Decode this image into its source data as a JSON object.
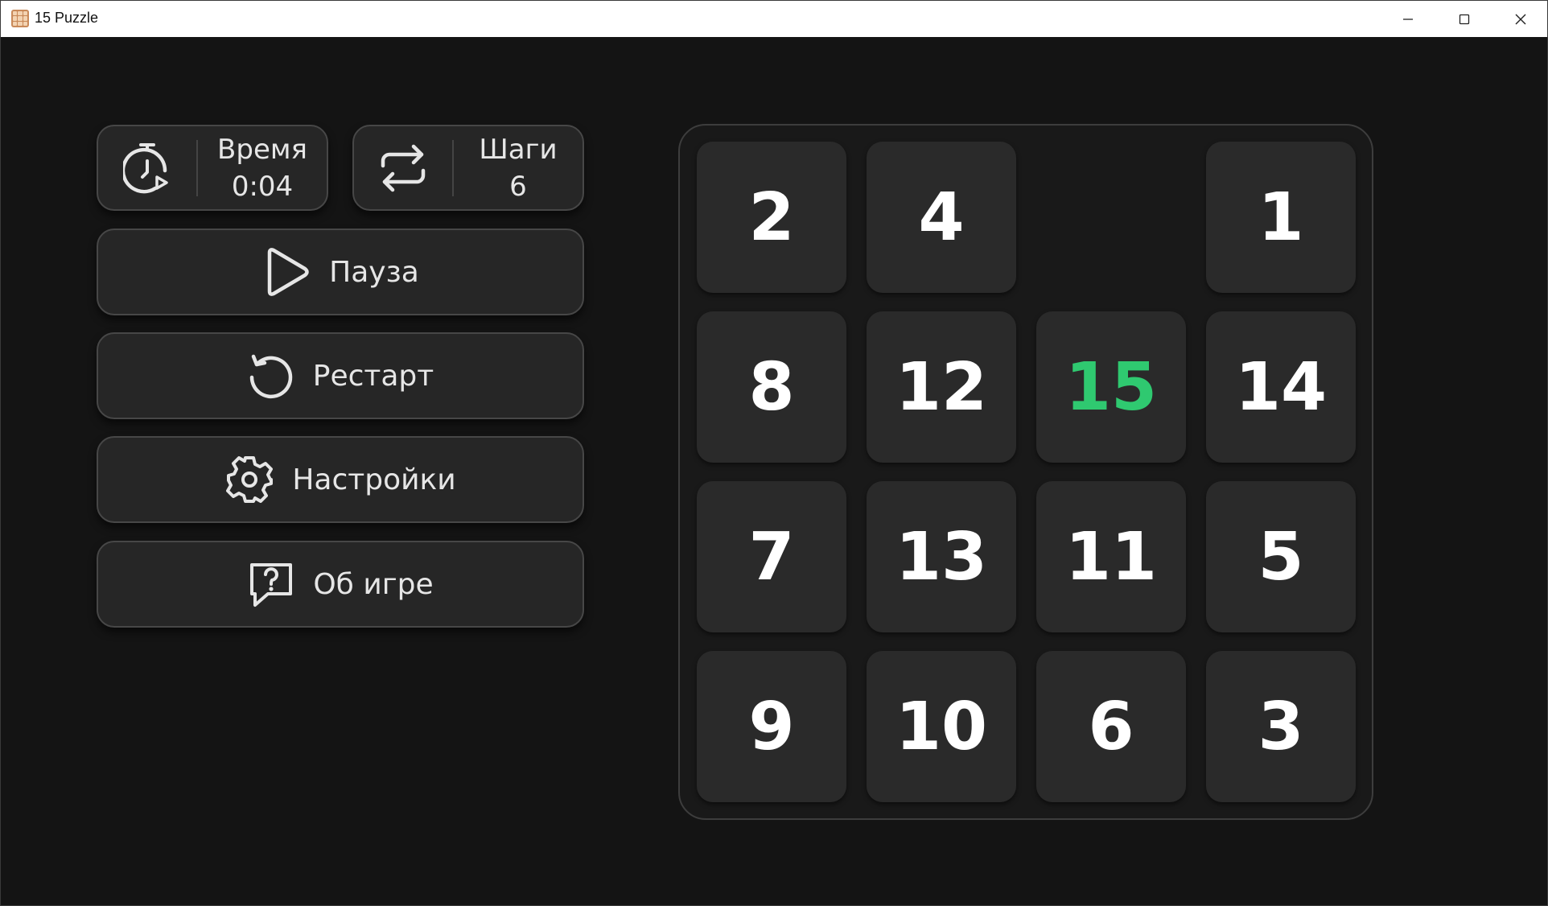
{
  "window": {
    "title": "15 Puzzle",
    "controls": {
      "minimize": "minimize-icon",
      "maximize": "maximize-icon",
      "close": "close-icon"
    }
  },
  "stats": {
    "time": {
      "label": "Время",
      "value": "0:04",
      "icon": "stopwatch-icon"
    },
    "steps": {
      "label": "Шаги",
      "value": "6",
      "icon": "repeat-icon"
    }
  },
  "buttons": {
    "pause": {
      "label": "Пауза",
      "icon": "play-icon"
    },
    "restart": {
      "label": "Рестарт",
      "icon": "restart-icon"
    },
    "settings": {
      "label": "Настройки",
      "icon": "gear-icon"
    },
    "about": {
      "label": "Об игре",
      "icon": "help-bubble-icon"
    }
  },
  "board": {
    "rows": [
      [
        "2",
        "4",
        "",
        "1"
      ],
      [
        "8",
        "12",
        "15",
        "14"
      ],
      [
        "7",
        "13",
        "11",
        "5"
      ],
      [
        "9",
        "10",
        "6",
        "3"
      ]
    ],
    "correct_tiles": [
      "15"
    ],
    "colors": {
      "correct": "#2fc970",
      "tile_text": "#ffffff",
      "tile_bg": "#2a2a2a"
    }
  }
}
